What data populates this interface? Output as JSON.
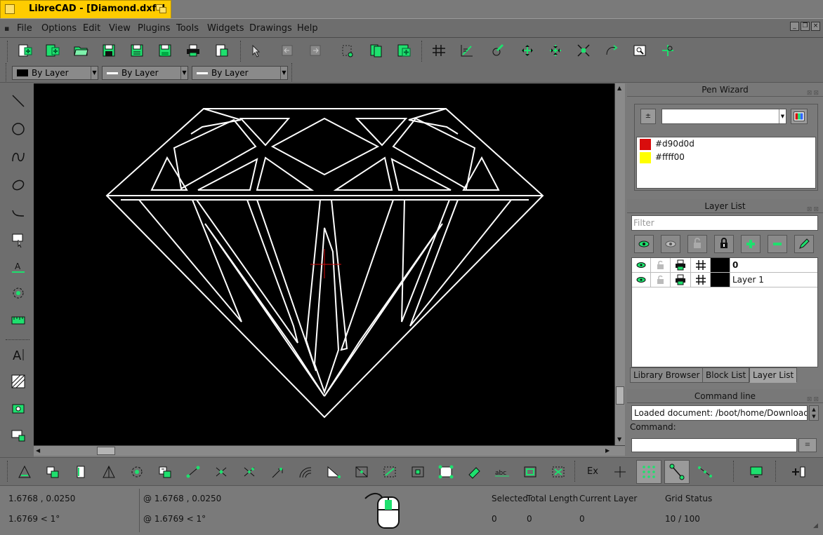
{
  "window": {
    "title": "LibreCAD - [Diamond.dxf*]"
  },
  "menu": {
    "items": [
      "File",
      "Options",
      "Edit",
      "View",
      "Plugins",
      "Tools",
      "Widgets",
      "Drawings",
      "Help"
    ]
  },
  "propbar": {
    "color": "By Layer",
    "width": "By Layer",
    "linetype": "By Layer"
  },
  "pen_wizard": {
    "title": "Pen Wizard",
    "pens": [
      {
        "label": "#d90d0d",
        "color": "#d90d0d"
      },
      {
        "label": "#ffff00",
        "color": "#ffff00"
      }
    ]
  },
  "layer_list": {
    "title": "Layer List",
    "filter_placeholder": "Filter",
    "layers": [
      {
        "name": "0",
        "color": "#000000",
        "bold": true
      },
      {
        "name": "Layer 1",
        "color": "#000000",
        "bold": false
      }
    ]
  },
  "dock_tabs": [
    "Library Browser",
    "Block List",
    "Layer List"
  ],
  "command_line": {
    "title": "Command line",
    "output": "Loaded document: /boot/home/Downloads/",
    "label": "Command:"
  },
  "snap": {
    "ex_label": "Ex"
  },
  "status": {
    "abs_cart": "1.6768 , 0.0250",
    "abs_polar": "1.6769 < 1°",
    "rel_cart": "@  1.6768 , 0.0250",
    "rel_polar": "@  1.6769 < 1°",
    "selected_label": "Selected",
    "selected_value": "0",
    "total_length_label": "Total Length",
    "total_length_value": "0",
    "current_layer_label": "Current Layer",
    "current_layer_value": "0",
    "grid_status_label": "Grid Status",
    "grid_status_value": "10 / 100"
  },
  "colors": {
    "accent_green": "#1ee06e",
    "title_tab": "#ffcc00",
    "drawing_bg": "#000000",
    "drawing_line": "#ffffff"
  }
}
